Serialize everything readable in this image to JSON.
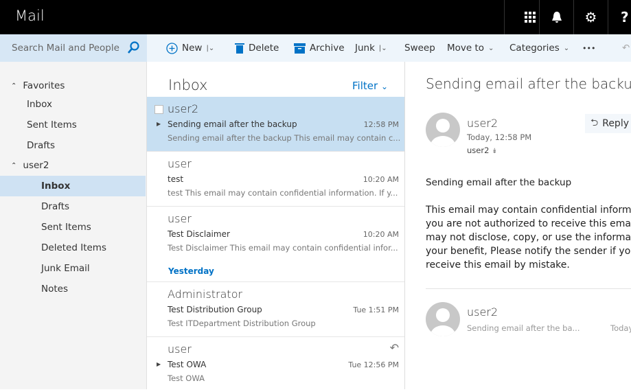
{
  "app": {
    "title": "Mail"
  },
  "topbar": {
    "icons": [
      "app-launcher-icon",
      "bell-icon",
      "gear-icon",
      "help-icon"
    ],
    "help_glyph": "?"
  },
  "search": {
    "placeholder": "Search Mail and People"
  },
  "toolbar": {
    "new": "New",
    "delete": "Delete",
    "archive": "Archive",
    "junk": "Junk",
    "sweep": "Sweep",
    "move_to": "Move to",
    "categories": "Categories",
    "more": "•••"
  },
  "sidebar": {
    "favorites": "Favorites",
    "fav_items": [
      "Inbox",
      "Sent Items",
      "Drafts"
    ],
    "account": "user2",
    "items": [
      "Inbox",
      "Drafts",
      "Sent Items",
      "Deleted Items",
      "Junk Email",
      "Notes"
    ],
    "selected": "Inbox"
  },
  "list": {
    "title": "Inbox",
    "filter": "Filter",
    "yesterday": "Yesterday",
    "messages": [
      {
        "from": "user2",
        "subject": "Sending email after the backup",
        "time": "12:58 PM",
        "preview": "Sending email after the backup This email may contain c..."
      },
      {
        "from": "user",
        "subject": "test",
        "time": "10:20 AM",
        "preview": "test This email may contain confidential information. If y..."
      },
      {
        "from": "user",
        "subject": "Test Disclaimer",
        "time": "10:20 AM",
        "preview": "Test Disclaimer This email may contain confidential infor..."
      },
      {
        "from": "Administrator",
        "subject": "Test Distribution Group",
        "time": "Tue 1:51 PM",
        "preview": "Test ITDepartment Distribution Group"
      },
      {
        "from": "user",
        "subject": "Test OWA",
        "time": "Tue 12:56 PM",
        "preview": "Test OWA"
      }
    ]
  },
  "reading": {
    "subject": "Sending email after the backup",
    "from": "user2",
    "date": "Today, 12:58 PM",
    "to": "user2",
    "reply": "Reply",
    "body_title": "Sending email after the backup",
    "body_lines": [
      "This email may contain confidential informati",
      "you are not authorized to receive this email, y",
      "may not disclose, copy, or use the informatio",
      "your benefit, Please notify the sender if you a",
      "receive this email by mistake."
    ],
    "thread": {
      "from": "user2",
      "preview": "Sending email after the ba...",
      "time": "Today"
    }
  },
  "colors": {
    "accent": "#0072c6",
    "selected": "#c7dff2",
    "topbar": "#000000"
  }
}
